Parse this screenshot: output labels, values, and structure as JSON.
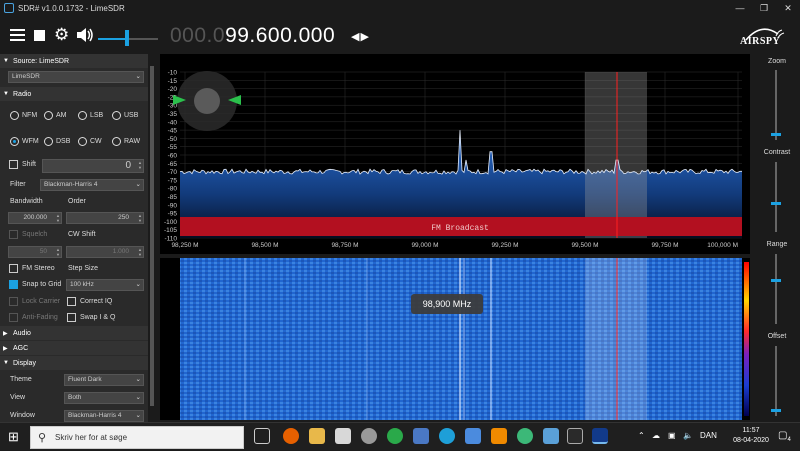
{
  "window": {
    "title": "SDR# v1.0.0.1732 - LimeSDR"
  },
  "toolbar": {
    "freq_dim": "000.0",
    "freq_lit": "99.600.000",
    "freq_arrows": "◀▶",
    "logo_text": "AIRSPY",
    "volume_level": 0.48
  },
  "source": {
    "header": "Source: LimeSDR",
    "device": "LimeSDR"
  },
  "radio": {
    "header": "Radio",
    "modes": [
      "NFM",
      "AM",
      "LSB",
      "USB",
      "WFM",
      "DSB",
      "CW",
      "RAW"
    ],
    "selected_mode": "WFM",
    "shift_label": "Shift",
    "shift_value": "0",
    "filter_label": "Filter",
    "filter_value": "Blackman-Harris 4",
    "bandwidth_label": "Bandwidth",
    "order_label": "Order",
    "bandwidth_value": "200.000",
    "order_value": "250",
    "squelch_label": "Squelch",
    "cwshift_label": "CW Shift",
    "squelch_value": "50",
    "cwshift_value": "1.000",
    "fmstereo_label": "FM Stereo",
    "stepsize_label": "Step Size",
    "snap_label": "Snap to Grid",
    "step_value": "100 kHz",
    "lockcarrier_label": "Lock Carrier",
    "correctiq_label": "Correct IQ",
    "antifading_label": "Anti-Fading",
    "swapiq_label": "Swap I & Q"
  },
  "sections": {
    "audio": "Audio",
    "agc": "AGC",
    "display": "Display"
  },
  "display": {
    "theme_label": "Theme",
    "theme_value": "Fluent Dark",
    "view_label": "View",
    "view_value": "Both",
    "window_label": "Window",
    "window_value": "Blackman-Harris 4"
  },
  "spectrum": {
    "y_ticks": [
      "-10",
      "-15",
      "-20",
      "-25",
      "-30",
      "-35",
      "-40",
      "-45",
      "-50",
      "-55",
      "-60",
      "-65",
      "-70",
      "-75",
      "-80",
      "-85",
      "-90",
      "-95",
      "-100",
      "-105",
      "-110"
    ],
    "x_ticks": [
      "98,250 M",
      "98,500 M",
      "98,750 M",
      "99,000 M",
      "99,250 M",
      "99,500 M",
      "99,750 M",
      "100,000 M"
    ],
    "band_label": "FM Broadcast",
    "tooltip": "98,900 MHz"
  },
  "right": {
    "zoom": "Zoom",
    "contrast": "Contrast",
    "range": "Range",
    "offset": "Offset"
  },
  "taskbar": {
    "search_placeholder": "Skriv her for at søge",
    "language": "DAN",
    "time": "11:57",
    "date": "08-04-2020",
    "notif_count": "4"
  },
  "colors": {
    "accent": "#1ba1e2",
    "band": "#b31020",
    "marker": "#ff2020"
  }
}
